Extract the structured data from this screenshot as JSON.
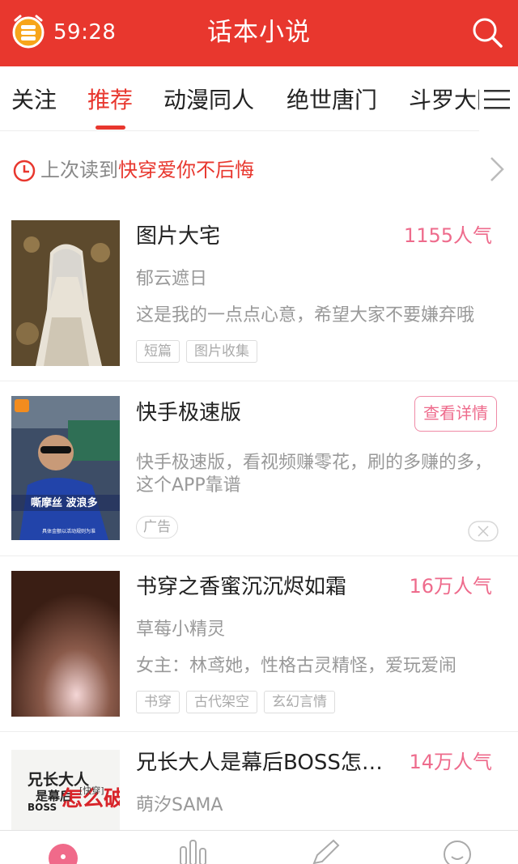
{
  "header": {
    "timer": "59:28",
    "title": "话本小说",
    "coin_icon": "coin-alarm-icon",
    "search_icon": "search-icon",
    "accent_color": "#e8372e"
  },
  "tabs": [
    {
      "label": "关注",
      "active": false
    },
    {
      "label": "推荐",
      "active": true
    },
    {
      "label": "动漫同人",
      "active": false
    },
    {
      "label": "绝世唐门",
      "active": false
    },
    {
      "label": "斗罗大陆",
      "active": false
    }
  ],
  "last_read": {
    "prefix": "上次读到",
    "book": "快穿爱你不后悔"
  },
  "items": [
    {
      "title": "图片大宅",
      "popularity": "1155人气",
      "author": "郁云遮日",
      "description": "这是我的一点点心意，希望大家不要嫌弃哦",
      "tags": [
        "短篇",
        "图片收集"
      ]
    },
    {
      "title": "书穿之香蜜沉沉烬如霜",
      "popularity": "16万人气",
      "author": "草莓小精灵",
      "description": "女主：林鸢她，性格古灵精怪，爱玩爱闹",
      "tags": [
        "书穿",
        "古代架空",
        "玄幻言情"
      ]
    },
    {
      "title": "兄长大人是幕后BOSS怎么破",
      "popularity": "14万人气",
      "author": "萌汐SAMA",
      "description": "",
      "tags": []
    }
  ],
  "ad": {
    "title": "快手极速版",
    "button": "查看详情",
    "description": "快手极速版，看视频赚零花，刷的多赚的多，这个APP靠谱",
    "tag": "广告",
    "cover_caption": "嘶摩丝 波浪多",
    "cover_subcaption": "具体金额以活动规则为准"
  },
  "covers": {
    "book3_line1": "兄长大人",
    "book3_line2": "是幕后",
    "book3_line3": "BOSS",
    "book3_line4": "怎么破",
    "book3_tag": "[快穿]"
  },
  "bottom_nav": [
    "home-icon",
    "ranking-icon",
    "write-icon",
    "profile-icon"
  ]
}
